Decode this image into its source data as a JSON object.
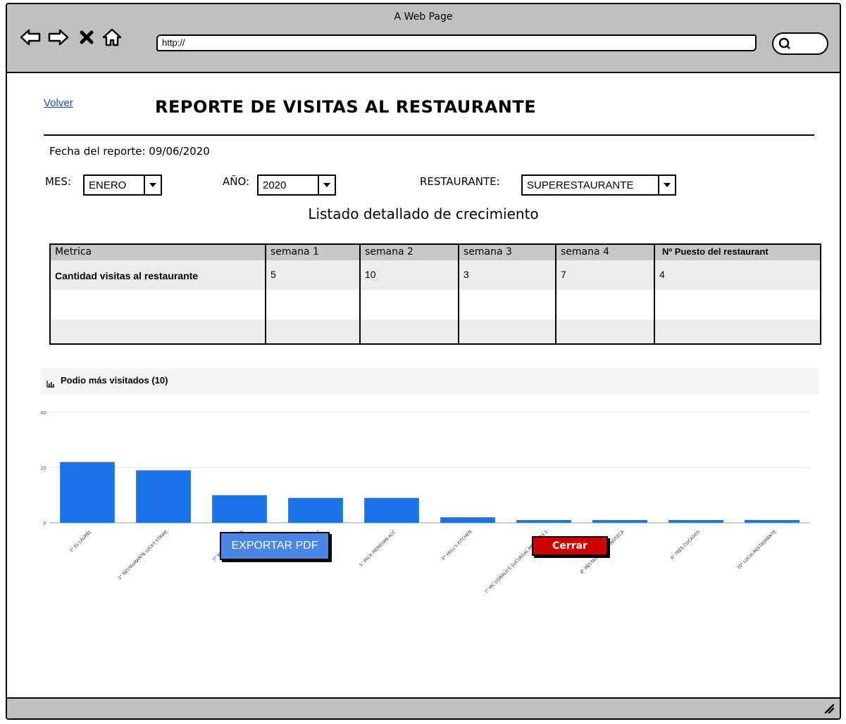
{
  "window": {
    "title": "A Web Page",
    "url": "http://"
  },
  "page": {
    "back_link": "Volver",
    "title": "REPORTE DE VISITAS AL RESTAURANTE",
    "report_date": "Fecha del reporte: 09/06/2020",
    "filters": {
      "month_label": "MES:",
      "month_value": "ENERO",
      "year_label": "AÑO:",
      "year_value": "2020",
      "restaurant_label": "RESTAURANTE:",
      "restaurant_value": "SUPERESTAURANTE"
    },
    "table_heading": "Listado detallado de crecimiento",
    "table": {
      "headers": [
        "Metrica",
        "semana 1",
        "semana 2",
        "semana 3",
        "semana 4",
        "Nº Puesto del restaurant"
      ],
      "rows": [
        [
          "Cantidad visitas al restaurante",
          "5",
          "10",
          "3",
          "7",
          "4"
        ],
        [
          "",
          "",
          "",
          "",
          "",
          ""
        ],
        [
          "",
          "",
          "",
          "",
          "",
          ""
        ]
      ]
    },
    "chart_panel_title": "Podio más visitados (10)",
    "export_button": "EXPORTAR PDF",
    "close_button": "Cerrar"
  },
  "colors": {
    "bar": "#1a73e8",
    "export": "#4a86e8",
    "close": "#d10000",
    "chrome": "#c0c0c0"
  },
  "icons": [
    "back-arrow-icon",
    "forward-arrow-icon",
    "stop-icon",
    "home-icon",
    "search-icon",
    "bar-chart-icon",
    "resize-grip-icon"
  ],
  "chart_data": {
    "type": "bar",
    "categories": [
      "1° EL LAUREL",
      "2° RESTAURANTE LUCKY STRIKE",
      "3° WILLIAM BROWN",
      "4° ZAHAV",
      "5° PACK MERIDIAN ACC",
      "6° HELL'S KITCHEN",
      "7° MC DONALD'S SUCURSAL MENDOZA 1",
      "8° RESTAURANTE VINOTECA",
      "9° TRES COCADOS",
      "10° LUCIA RESTAURANTE"
    ],
    "values": [
      22,
      19,
      10,
      9,
      9,
      2,
      1,
      1,
      1,
      1
    ],
    "yticks": [
      "40",
      "20",
      "0"
    ],
    "ylim": [
      0,
      40
    ],
    "grid": true,
    "legend": "none"
  }
}
